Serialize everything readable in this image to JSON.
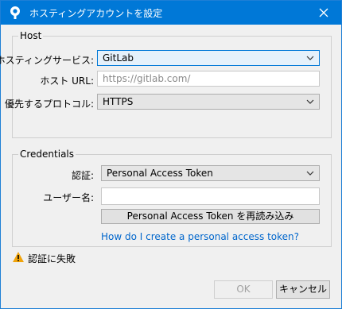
{
  "window": {
    "title": "ホスティングアカウントを設定"
  },
  "host": {
    "legend": "Host",
    "service_label": "ホスティングサービス:",
    "service_value": "GitLab",
    "url_label": "ホスト URL:",
    "url_placeholder": "https://gitlab.com/",
    "protocol_label": "優先するプロトコル:",
    "protocol_value": "HTTPS"
  },
  "credentials": {
    "legend": "Credentials",
    "auth_label": "認証:",
    "auth_value": "Personal Access Token",
    "username_label": "ユーザー名:",
    "username_value": "",
    "reload_button": "Personal Access Token を再読み込み",
    "help_link": "How do I create a personal access token?"
  },
  "status": {
    "message": "認証に失敗",
    "icon": "warning-icon"
  },
  "footer": {
    "ok_label": "OK",
    "cancel_label": "キャンセル"
  },
  "colors": {
    "titlebar": "#0078d7",
    "link": "#0066cc",
    "warning": "#f0a30a"
  }
}
